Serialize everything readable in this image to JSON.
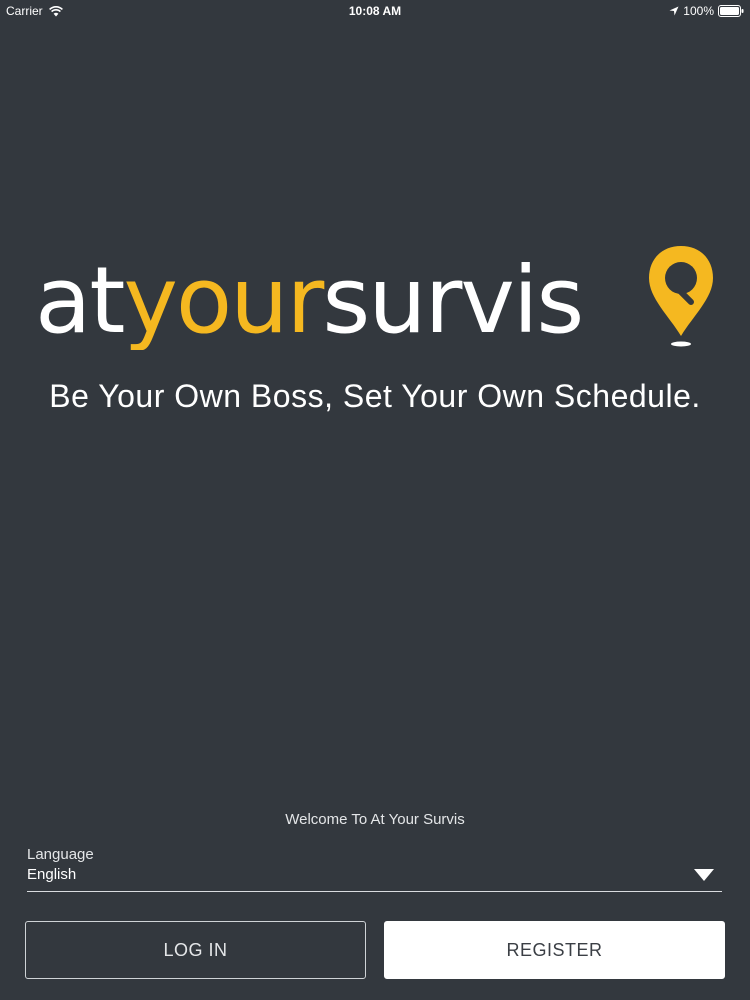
{
  "status_bar": {
    "carrier": "Carrier",
    "time": "10:08 AM",
    "battery": "100%"
  },
  "logo": {
    "part_at": "at",
    "part_your": "your",
    "part_survis": "survis",
    "accent_color": "#f5b820",
    "text_color": "#ffffff"
  },
  "tagline": "Be Your Own Boss, Set Your Own Schedule.",
  "welcome_text": "Welcome To At Your Survis",
  "language": {
    "label": "Language",
    "value": "English"
  },
  "buttons": {
    "login_label": "LOG IN",
    "register_label": "REGISTER"
  },
  "icons": [
    "wifi-icon",
    "location-arrow-icon",
    "battery-icon",
    "map-pin-icon",
    "chevron-down-icon"
  ],
  "colors": {
    "background": "#33383e",
    "accent": "#f5b820"
  }
}
